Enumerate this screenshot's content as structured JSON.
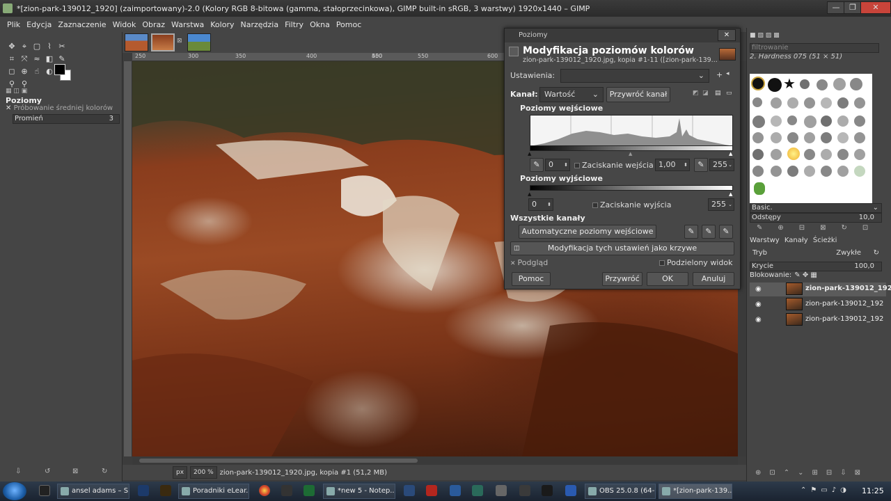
{
  "window": {
    "title": "*[zion-park-139012_1920] (zaimportowany)-2.0 (Kolory RGB 8-bitowa (gamma, stałoprzecinkowa), GIMP built-in sRGB, 3 warstwy) 1920x1440 – GIMP",
    "minimize": "—",
    "maximize": "❐",
    "close": "✕"
  },
  "menu": [
    "Plik",
    "Edycja",
    "Zaznaczenie",
    "Widok",
    "Obraz",
    "Warstwa",
    "Kolory",
    "Narzędzia",
    "Filtry",
    "Okna",
    "Pomoc"
  ],
  "tool_options": {
    "title": "Poziomy",
    "option1": "Próbowanie średniej kolorów",
    "radius_label": "Promień",
    "radius_value": "3"
  },
  "ruler_top": [
    "250",
    "300",
    "350",
    "400",
    "450",
    "500",
    "550",
    "600"
  ],
  "status": {
    "unit": "px",
    "zoom": "200 %",
    "info": "zion-park-139012_1920.jpg, kopia #1 (51,2 MB)"
  },
  "dialog": {
    "window_title": "Poziomy",
    "heading": "Modyfikacja poziomów kolorów",
    "subheading": "zion-park-139012_1920.jpg, kopia #1-11 ([zion-park-139...",
    "presets_label": "Ustawienia:",
    "channel_label": "Kanał:",
    "channel_value": "Wartość",
    "reset_channel": "Przywróć kanał",
    "input_levels": "Poziomy wejściowe",
    "input_low": "0",
    "clamp_input": "Zaciskanie wejścia",
    "gamma": "1,00",
    "input_high": "255",
    "output_levels": "Poziomy wyjściowe",
    "output_low": "0",
    "clamp_output": "Zaciskanie wyjścia",
    "output_high": "255",
    "all_channels": "Wszystkie kanały",
    "auto_input": "Automatyczne poziomy wejściowe",
    "edit_as_curves": "Modyfikacja tych ustawień jako krzywe",
    "preview": "Podgląd",
    "split_view": "Podzielony widok",
    "help": "Pomoc",
    "reset": "Przywróć",
    "ok": "OK",
    "cancel": "Anuluj"
  },
  "right_dock": {
    "filter_placeholder": "filtrowanie",
    "brush_name": "2. Hardness 075 (51 × 51)",
    "brush_set": "Basic.",
    "spacing_label": "Odstępy",
    "spacing_value": "10,0",
    "tabs": [
      "Warstwy",
      "Kanały",
      "Ścieżki"
    ],
    "mode_label": "Tryb",
    "mode_value": "Zwykłe",
    "opacity_label": "Krycie",
    "opacity_value": "100,0",
    "lock_label": "Blokowanie:",
    "layers": [
      "zion-park-139012_192",
      "zion-park-139012_192",
      "zion-park-139012_192"
    ]
  },
  "taskbar": {
    "items": [
      "ansel adams – S...",
      "Poradniki eLear...",
      "*new 5 - Notep...",
      "OBS 25.0.8 (64-...",
      "*[zion-park-139..."
    ],
    "clock": "11:25"
  }
}
